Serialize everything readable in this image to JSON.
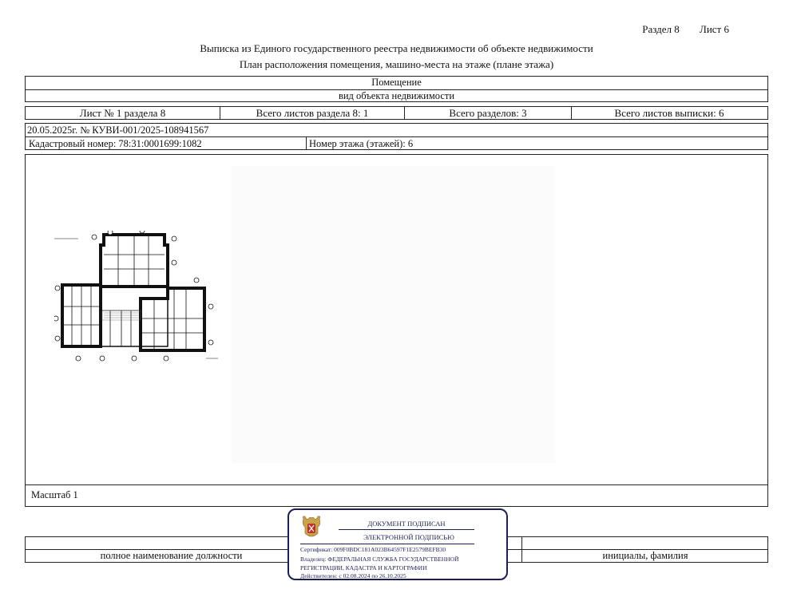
{
  "header": {
    "section": "Раздел 8",
    "sheet": "Лист 6",
    "title": "Выписка из Единого государственного реестра недвижимости об объекте недвижимости",
    "subtitle": "План расположения помещения, машино-места на этаже (плане этажа)"
  },
  "object": {
    "type_value": "Помещение",
    "type_label": "вид объекта недвижимости"
  },
  "sheets": {
    "sheet_no": "Лист № 1 раздела 8",
    "total_section_sheets": "Всего листов раздела 8: 1",
    "total_sections": "Всего разделов: 3",
    "total_extract_sheets": "Всего листов выписки: 6"
  },
  "doc": {
    "date_number": "20.05.2025г. № КУВИ-001/2025-108941567",
    "cadastral": "Кадастровый номер: 78:31:0001699:1082",
    "floor": "Номер этажа (этажей): 6"
  },
  "plan": {
    "scale": "Масштаб 1"
  },
  "signature": {
    "position_label": "полное наименование должности",
    "initials_label": "инициалы, фамилия"
  },
  "stamp": {
    "line1": "ДОКУМЕНТ ПОДПИСАН",
    "line2": "ЭЛЕКТРОННОЙ ПОДПИСЬЮ",
    "cert": "Сертификат: 009F0BDC181A023B64597F1E2579BEFB30",
    "owner1": "Владелец: ФЕДЕРАЛЬНАЯ СЛУЖБА ГОСУДАРСТВЕННОЙ",
    "owner2": "РЕГИСТРАЦИИ, КАДАСТРА И КАРТОГРАФИИ",
    "valid": "Действителен: с 02.08.2024 по 26.10.2025"
  }
}
